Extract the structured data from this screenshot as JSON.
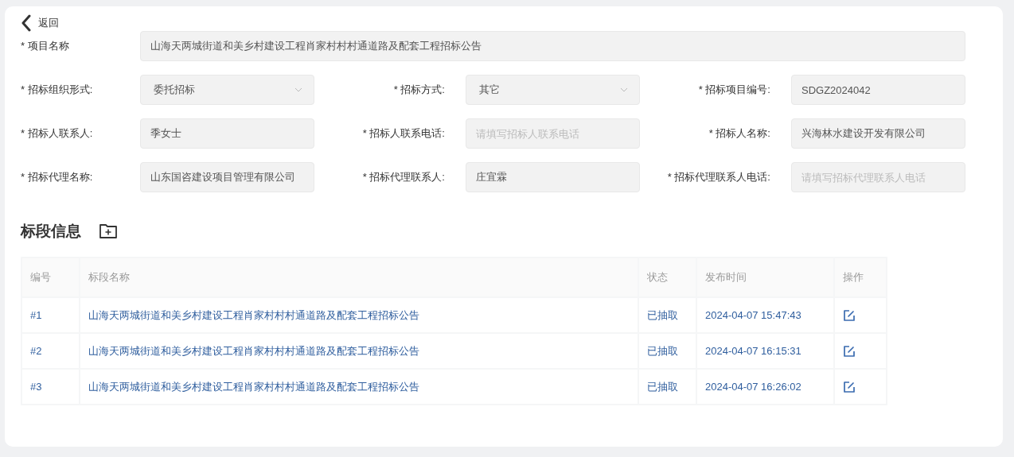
{
  "back": {
    "label": "返回"
  },
  "project_name": {
    "label": "* 项目名称",
    "value": "山海天两城街道和美乡村建设工程肖家村村村通道路及配套工程招标公告"
  },
  "fields": [
    {
      "label": "* 招标组织形式:",
      "kind": "select",
      "value": "委托招标"
    },
    {
      "label": "* 招标方式:",
      "kind": "select",
      "value": "其它"
    },
    {
      "label": "* 招标项目编号:",
      "kind": "text",
      "value": "SDGZ2024042"
    },
    {
      "label": "* 招标人联系人:",
      "kind": "text",
      "value": "季女士"
    },
    {
      "label": "* 招标人联系电话:",
      "kind": "text",
      "placeholder": "请填写招标人联系电话"
    },
    {
      "label": "* 招标人名称:",
      "kind": "text",
      "value": "兴海林水建设开发有限公司"
    },
    {
      "label": "* 招标代理名称:",
      "kind": "text",
      "value": "山东国咨建设项目管理有限公司"
    },
    {
      "label": "* 招标代理联系人:",
      "kind": "text",
      "value": "庄宜霖"
    },
    {
      "label": "* 招标代理联系人电话:",
      "kind": "text",
      "placeholder": "请填写招标代理联系人电话"
    }
  ],
  "section": {
    "title": "标段信息"
  },
  "table": {
    "columns": [
      "编号",
      "标段名称",
      "状态",
      "发布时间",
      "操作"
    ],
    "rows": [
      {
        "id": "#1",
        "name": "山海天两城街道和美乡村建设工程肖家村村村通道路及配套工程招标公告",
        "status": "已抽取",
        "time": "2024-04-07 15:47:43"
      },
      {
        "id": "#2",
        "name": "山海天两城街道和美乡村建设工程肖家村村村通道路及配套工程招标公告",
        "status": "已抽取",
        "time": "2024-04-07 16:15:31"
      },
      {
        "id": "#3",
        "name": "山海天两城街道和美乡村建设工程肖家村村村通道路及配套工程招标公告",
        "status": "已抽取",
        "time": "2024-04-07 16:26:02"
      }
    ]
  }
}
